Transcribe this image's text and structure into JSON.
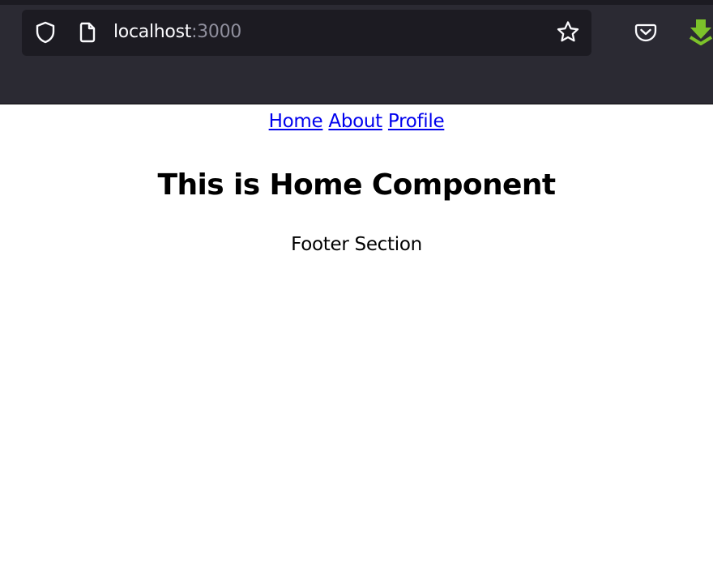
{
  "browser": {
    "url_host": "localhost",
    "url_port": ":3000",
    "icons": {
      "security": "shield-icon",
      "page": "page-icon",
      "bookmark": "star-icon",
      "pocket": "pocket-icon",
      "extension": "download-icon"
    },
    "colors": {
      "toolbar": "#2b2a33",
      "urlbar": "#1c1b22",
      "url_text": "#fbfbfe",
      "url_port": "#8f8f9d",
      "extension_icon": "#7cc22a"
    }
  },
  "page": {
    "nav": {
      "home": "Home",
      "about": "About",
      "profile": "Profile"
    },
    "title": "This is Home Component",
    "footer": "Footer Section",
    "colors": {
      "link": "#0000ee",
      "text": "#000000",
      "background": "#ffffff"
    }
  }
}
